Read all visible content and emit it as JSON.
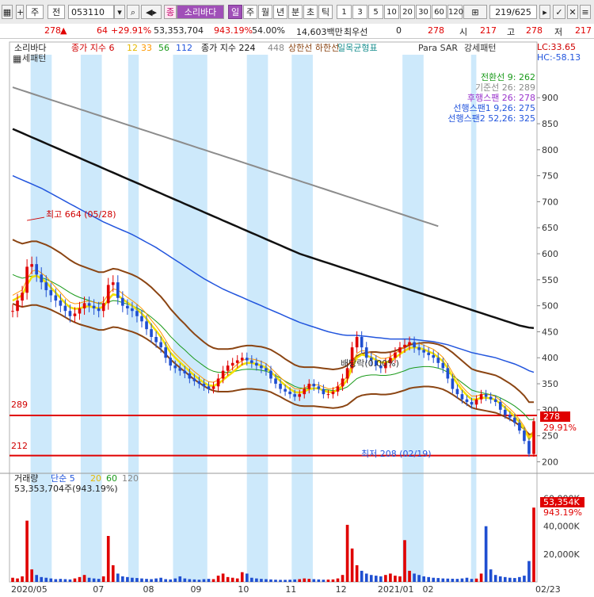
{
  "toolbar": {
    "market": "주",
    "period_type": "전",
    "code": "053110",
    "name_badge": "종",
    "name": "소리바다",
    "tabs": [
      "일",
      "주",
      "월",
      "년",
      "분",
      "초",
      "틱"
    ],
    "intervals": [
      "1",
      "3",
      "5",
      "10",
      "20",
      "30",
      "60",
      "120"
    ],
    "page": "219/625"
  },
  "infobar": {
    "price": "278",
    "change": "64",
    "change_pct": "+29.91%",
    "volume": "53,353,704",
    "volume_pct": "943.19%",
    "turnover_pct": "54.00%",
    "amount": "14,603백만",
    "stock_type": "최우선",
    "zero": "0",
    "current": "278",
    "open_label": "시",
    "open": "217",
    "high_label": "고",
    "high": "278",
    "low_label": "저",
    "low": "217"
  },
  "legend": {
    "name": "소리바다",
    "ma_label": "종가 지수 6",
    "ma_periods": [
      "12",
      "33",
      "56",
      "112"
    ],
    "ma2_label": "종가 지수 224",
    "ma2_period": "448",
    "envelope": "상한선 하한선",
    "ichimoku": "일목균형표",
    "psar": "Para SAR",
    "strong": "강세패턴",
    "extra": "세패턴"
  },
  "ichimoku_box": [
    "전환선 9: 262",
    "기준선 26: 289",
    "후행스팬 26: 278",
    "선행스팬1 9,26: 275",
    "선행스팬2 52,26: 325"
  ],
  "corner": {
    "lc": "LC:33.65",
    "hc": "HC:-58.13"
  },
  "annotations": {
    "high": "최고 664 (05/28)",
    "low": "최저 208 (02/19)",
    "dividend": "배당락(0.00%)",
    "hline1": "289",
    "hline2": "212",
    "price_tag": "278",
    "price_pct": "29.91%"
  },
  "volume_panel": {
    "title": "거래량",
    "ma_label": "단순 5",
    "ma_periods": [
      "20",
      "60",
      "120"
    ],
    "value": "53,353,704주(943.19%)",
    "tag": "53,354K",
    "tag_pct": "943.19%"
  },
  "chart_data": {
    "type": "candlestick",
    "price_axis": {
      "ticks": [
        200,
        250,
        300,
        350,
        400,
        450,
        500,
        550,
        600,
        650,
        700,
        750,
        800,
        850,
        900
      ],
      "ylim": [
        190,
        940
      ]
    },
    "volume_axis": {
      "ticks": [
        "20,000K",
        "40,000K",
        "60,000K"
      ],
      "values": [
        20000,
        40000,
        60000
      ],
      "ylim": [
        0,
        70000
      ]
    },
    "x_ticks": [
      "2020/05",
      "07",
      "08",
      "09",
      "10",
      "11",
      "12",
      "2021/01",
      "02",
      "02/23"
    ],
    "close_series": [
      490,
      510,
      525,
      575,
      580,
      560,
      545,
      530,
      520,
      510,
      500,
      490,
      480,
      485,
      495,
      505,
      500,
      495,
      490,
      505,
      540,
      545,
      515,
      500,
      495,
      490,
      480,
      470,
      455,
      440,
      430,
      420,
      400,
      385,
      380,
      375,
      370,
      360,
      355,
      350,
      345,
      340,
      345,
      360,
      375,
      385,
      390,
      395,
      400,
      395,
      390,
      385,
      380,
      375,
      360,
      350,
      340,
      335,
      330,
      325,
      330,
      340,
      350,
      345,
      340,
      330,
      330,
      335,
      345,
      360,
      380,
      420,
      440,
      420,
      400,
      395,
      385,
      380,
      390,
      400,
      410,
      420,
      425,
      430,
      420,
      415,
      410,
      405,
      400,
      390,
      380,
      360,
      340,
      330,
      320,
      315,
      310,
      320,
      330,
      325,
      320,
      315,
      300,
      290,
      285,
      275,
      260,
      240,
      215,
      278
    ],
    "ema_short": [
      510,
      515,
      520,
      540,
      555,
      558,
      552,
      545,
      535,
      525,
      515,
      505,
      497,
      494,
      495,
      498,
      499,
      497,
      495,
      498,
      512,
      522,
      520,
      513,
      506,
      500,
      493,
      485,
      475,
      463,
      452,
      440,
      425,
      410,
      400,
      391,
      383,
      374,
      366,
      359,
      352,
      347,
      346,
      350,
      357,
      365,
      372,
      380,
      387,
      390,
      390,
      388,
      385,
      381,
      373,
      364,
      355,
      347,
      340,
      334,
      333,
      335,
      340,
      341,
      341,
      337,
      334,
      334,
      338,
      346,
      358,
      381,
      400,
      406,
      404,
      401,
      396,
      391,
      391,
      394,
      400,
      407,
      413,
      419,
      420,
      419,
      416,
      412,
      408,
      401,
      393,
      380,
      364,
      350,
      338,
      328,
      320,
      320,
      323,
      323,
      322,
      319,
      312,
      304,
      296,
      287,
      276,
      263,
      244,
      255
    ],
    "ema_mid": [
      560,
      556,
      553,
      555,
      557,
      557,
      554,
      551,
      547,
      542,
      537,
      531,
      525,
      520,
      516,
      513,
      510,
      507,
      504,
      504,
      507,
      510,
      509,
      506,
      503,
      500,
      496,
      491,
      485,
      478,
      470,
      462,
      452,
      441,
      432,
      423,
      415,
      406,
      398,
      391,
      384,
      378,
      374,
      372,
      372,
      372,
      373,
      375,
      377,
      378,
      378,
      377,
      376,
      374,
      371,
      366,
      361,
      355,
      350,
      345,
      342,
      341,
      341,
      341,
      340,
      339,
      338,
      337,
      338,
      340,
      344,
      352,
      360,
      364,
      366,
      367,
      367,
      366,
      366,
      367,
      369,
      372,
      375,
      379,
      381,
      382,
      383,
      383,
      382,
      380,
      377,
      372,
      366,
      359,
      352,
      345,
      338,
      335,
      333,
      331,
      329,
      327,
      323,
      318,
      313,
      307,
      300,
      292,
      281,
      281
    ],
    "ema_long": [
      750,
      746,
      742,
      738,
      734,
      730,
      726,
      721,
      716,
      711,
      706,
      701,
      696,
      691,
      686,
      681,
      676,
      671,
      666,
      661,
      657,
      653,
      649,
      645,
      641,
      637,
      632,
      627,
      622,
      617,
      612,
      606,
      600,
      594,
      588,
      582,
      576,
      570,
      564,
      558,
      552,
      547,
      542,
      537,
      532,
      528,
      524,
      520,
      516,
      512,
      508,
      504,
      500,
      496,
      492,
      488,
      484,
      480,
      476,
      472,
      468,
      465,
      462,
      459,
      456,
      453,
      450,
      448,
      446,
      444,
      443,
      443,
      443,
      442,
      441,
      440,
      439,
      438,
      437,
      436,
      436,
      436,
      436,
      436,
      435,
      434,
      433,
      432,
      431,
      429,
      427,
      425,
      422,
      419,
      416,
      413,
      410,
      408,
      406,
      404,
      402,
      400,
      397,
      394,
      391,
      388,
      384,
      380,
      375,
      372
    ],
    "ma224": [
      840,
      836,
      832,
      828,
      824,
      820,
      816,
      812,
      808,
      804,
      800,
      796,
      792,
      788,
      784,
      780,
      776,
      772,
      768,
      764,
      760,
      756,
      752,
      748,
      744,
      740,
      736,
      732,
      728,
      724,
      720,
      716,
      712,
      708,
      704,
      700,
      696,
      692,
      688,
      684,
      680,
      676,
      672,
      668,
      664,
      660,
      656,
      652,
      648,
      644,
      640,
      636,
      632,
      628,
      624,
      620,
      616,
      612,
      608,
      604,
      600,
      597,
      594,
      591,
      588,
      585,
      582,
      579,
      576,
      573,
      570,
      567,
      564,
      561,
      558,
      555,
      552,
      549,
      546,
      543,
      540,
      537,
      534,
      531,
      528,
      525,
      522,
      519,
      516,
      513,
      510,
      507,
      504,
      501,
      498,
      495,
      492,
      489,
      486,
      483,
      480,
      477,
      474,
      471,
      468,
      465,
      462,
      460,
      458,
      457
    ],
    "ma448": [
      920,
      917,
      914,
      911,
      908,
      905,
      902,
      899,
      896,
      893,
      890,
      887,
      884,
      881,
      878,
      875,
      872,
      869,
      866,
      863,
      860,
      857,
      854,
      851,
      848,
      845,
      842,
      839,
      836,
      833,
      830,
      827,
      824,
      821,
      818,
      815,
      812,
      809,
      806,
      803,
      800,
      797,
      794,
      791,
      788,
      785,
      782,
      779,
      776,
      773,
      770,
      767,
      764,
      761,
      758,
      755,
      752,
      749,
      746,
      743,
      740,
      737,
      734,
      731,
      728,
      725,
      722,
      719,
      716,
      713,
      710,
      707,
      704,
      701,
      698,
      695,
      692,
      689,
      686,
      683,
      680,
      677,
      674,
      671,
      668,
      665,
      662,
      659,
      656,
      653
    ],
    "volume": [
      3000,
      2500,
      4000,
      44000,
      9000,
      5000,
      3500,
      3000,
      2500,
      2000,
      2200,
      2000,
      1800,
      2500,
      3500,
      5000,
      3000,
      2500,
      2200,
      4000,
      33000,
      12000,
      6000,
      4000,
      3500,
      3000,
      2800,
      2500,
      2200,
      2000,
      2500,
      3000,
      2000,
      1800,
      2500,
      4000,
      2500,
      2000,
      1800,
      1600,
      2000,
      2200,
      2000,
      4500,
      6000,
      3500,
      3000,
      2500,
      7000,
      6000,
      3000,
      2500,
      2200,
      2000,
      1800,
      1600,
      1500,
      1500,
      1600,
      1800,
      2000,
      2500,
      2200,
      2000,
      1800,
      1600,
      1700,
      1800,
      2500,
      5000,
      41000,
      24000,
      12000,
      8000,
      6000,
      5000,
      4500,
      4000,
      5000,
      6000,
      4500,
      4000,
      30000,
      8000,
      6000,
      5000,
      4000,
      3500,
      3000,
      2800,
      2500,
      2400,
      2300,
      2200,
      2500,
      3000,
      2200,
      2400,
      6000,
      40000,
      9000,
      5000,
      4000,
      3500,
      3000,
      2800,
      3500,
      4500,
      15000,
      53354
    ],
    "highlight_bands": [
      [
        0.04,
        0.08
      ],
      [
        0.135,
        0.175
      ],
      [
        0.225,
        0.245
      ],
      [
        0.31,
        0.375
      ],
      [
        0.45,
        0.49
      ],
      [
        0.535,
        0.575
      ],
      [
        0.745,
        0.785
      ],
      [
        0.875,
        0.885
      ]
    ]
  }
}
